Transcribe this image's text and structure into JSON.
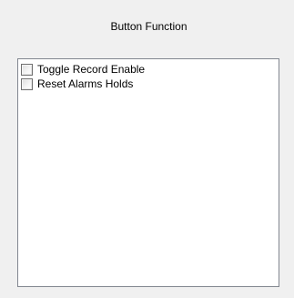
{
  "header": {
    "title": "Button Function"
  },
  "list": {
    "items": [
      {
        "label": "Toggle Record Enable",
        "checked": false
      },
      {
        "label": "Reset Alarms Holds",
        "checked": false
      }
    ]
  },
  "colors": {
    "background": "#f0f0f0",
    "list_background": "#ffffff",
    "list_border": "#828790",
    "checkbox_border": "#707070"
  }
}
